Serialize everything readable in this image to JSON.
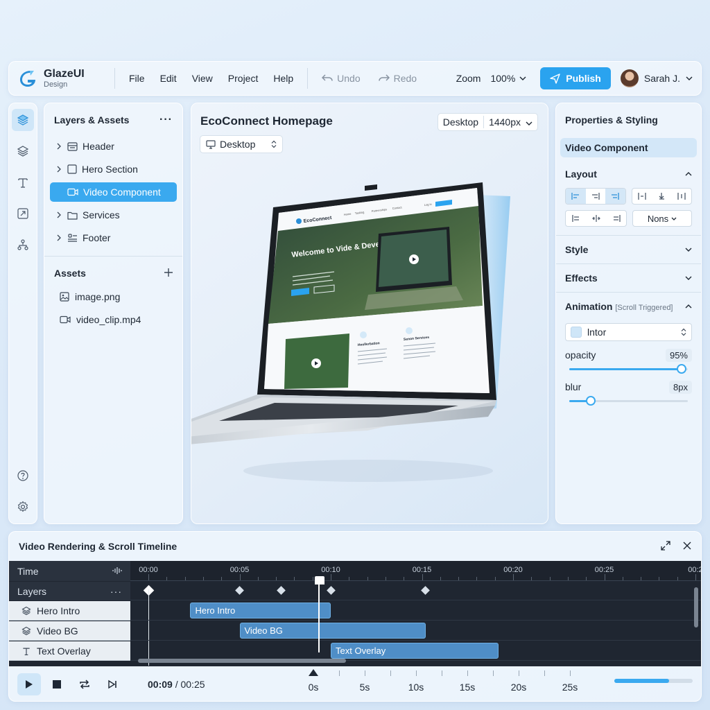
{
  "app": {
    "name": "GlazeUI",
    "subtitle": "Design"
  },
  "menu": [
    "File",
    "Edit",
    "View",
    "Project",
    "Help"
  ],
  "history": {
    "undo": "Undo",
    "redo": "Redo"
  },
  "zoom": {
    "label": "Zoom",
    "value": "100%"
  },
  "publish_label": "Publish",
  "user": {
    "name": "Sarah J."
  },
  "layers_panel": {
    "title": "Layers & Assets",
    "items": [
      {
        "label": "Header",
        "icon": "header-icon"
      },
      {
        "label": "Hero Section",
        "icon": "frame-icon"
      },
      {
        "label": "Video Component",
        "icon": "video-icon",
        "selected": true
      },
      {
        "label": "Services",
        "icon": "folder-icon"
      },
      {
        "label": "Footer",
        "icon": "footer-icon"
      }
    ],
    "assets_title": "Assets",
    "assets": [
      {
        "label": "image.png",
        "icon": "image-icon"
      },
      {
        "label": "video_clip.mp4",
        "icon": "video-icon"
      }
    ]
  },
  "canvas": {
    "title": "EcoConnect Homepage",
    "device": "Desktop",
    "resolution_device": "Desktop",
    "resolution": "1440px",
    "mockup": {
      "brand": "EcoConnect",
      "nav": [
        "Home",
        "Tasklog",
        "Partnerships",
        "Contact"
      ],
      "login": "Log in",
      "hero_title": "Welcome to Vide & Develop For Life",
      "card1_title": "Heollerbation",
      "card2_title": "Senon Services"
    }
  },
  "properties": {
    "title": "Properties & Styling",
    "selected": "Video Component",
    "layout_label": "Layout",
    "overflow_value": "Nons",
    "style_label": "Style",
    "effects_label": "Effects",
    "animation_label": "Animation",
    "animation_trigger": "[Scroll Triggered]",
    "easing_value": "Ɩntor",
    "opacity_label": "opacity",
    "opacity_value": "95%",
    "opacity_fraction": 0.95,
    "blur_label": "blur",
    "blur_value": "8px",
    "blur_fraction": 0.18
  },
  "timeline": {
    "title": "Video Rendering & Scroll Timeline",
    "time_label": "Time",
    "layers_label": "Layers",
    "ruler_labels": [
      "00:00",
      "00:05",
      "00:10",
      "00:15",
      "00:20",
      "00:25",
      "00:2"
    ],
    "tracks": [
      {
        "label": "Hero Intro",
        "clip": "Hero Intro",
        "start": 2.3,
        "end": 10.0
      },
      {
        "label": "Video BG",
        "clip": "Video BG",
        "start": 5.0,
        "end": 15.2
      },
      {
        "label": "Text Overlay",
        "clip": "Text Overlay",
        "start": 10.0,
        "end": 19.2
      }
    ],
    "keyframes": [
      0,
      5.0,
      7.3,
      10.0,
      15.2
    ],
    "playhead_seconds": 9.3,
    "current_time": "00:09",
    "total_time": "00:25",
    "mini_labels": [
      "0s",
      "5s",
      "10s",
      "15s",
      "20s",
      "25s"
    ],
    "progress_fraction": 0.7
  }
}
